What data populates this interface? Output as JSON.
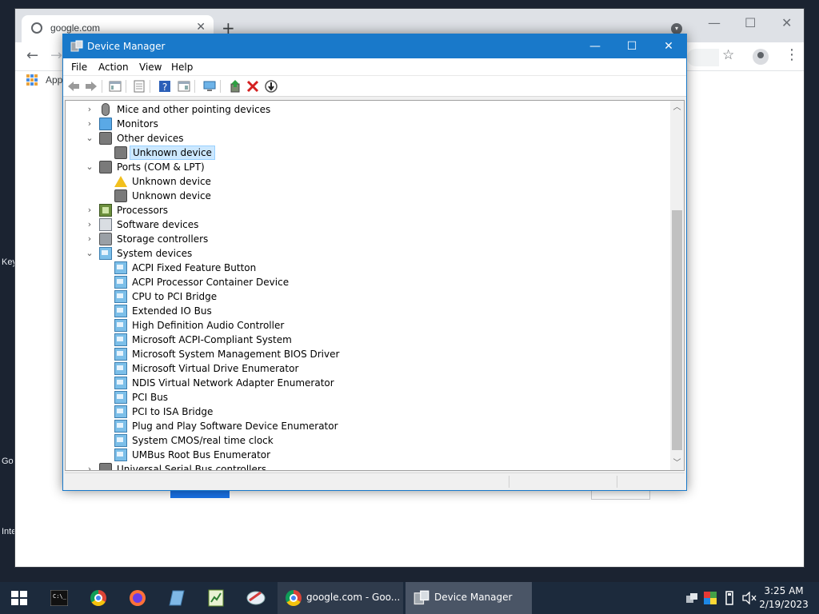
{
  "desktop": {
    "labels": [
      "Key",
      "Go",
      "Inte"
    ]
  },
  "chrome": {
    "tab_title": "google.com",
    "tab_close": "✕",
    "new_tab": "+",
    "bookmarks_label": "Apps",
    "win_minimize": "—",
    "win_maximize": "☐",
    "win_close": "✕"
  },
  "device_manager": {
    "title": "Device Manager",
    "window_controls": {
      "minimize": "—",
      "maximize": "☐",
      "close": "✕"
    },
    "menu": [
      "File",
      "Action",
      "View",
      "Help"
    ],
    "toolbar": [
      "back-icon",
      "forward-icon",
      "show-hide-console-tree-icon",
      "properties-icon",
      "help-icon",
      "action-pane-icon",
      "scan-hardware-icon",
      "update-driver-icon",
      "uninstall-device-icon",
      "disable-device-icon"
    ],
    "tree": [
      {
        "label": "Mice and other pointing devices",
        "level": 1,
        "expanded": false,
        "icon": "mouse-icon"
      },
      {
        "label": "Monitors",
        "level": 1,
        "expanded": false,
        "icon": "monitor-icon"
      },
      {
        "label": "Other devices",
        "level": 1,
        "expanded": true,
        "icon": "unknown-device-icon"
      },
      {
        "label": "Unknown device",
        "level": 2,
        "selected": true,
        "icon": "unknown-device-icon"
      },
      {
        "label": "Ports (COM & LPT)",
        "level": 1,
        "expanded": true,
        "icon": "port-icon"
      },
      {
        "label": "Unknown device",
        "level": 2,
        "icon": "warning-icon"
      },
      {
        "label": "Unknown device",
        "level": 2,
        "icon": "port-icon"
      },
      {
        "label": "Processors",
        "level": 1,
        "expanded": false,
        "icon": "processor-icon"
      },
      {
        "label": "Software devices",
        "level": 1,
        "expanded": false,
        "icon": "software-device-icon"
      },
      {
        "label": "Storage controllers",
        "level": 1,
        "expanded": false,
        "icon": "storage-controller-icon"
      },
      {
        "label": "System devices",
        "level": 1,
        "expanded": true,
        "icon": "system-device-icon"
      },
      {
        "label": "ACPI Fixed Feature Button",
        "level": 2,
        "icon": "system-device-icon"
      },
      {
        "label": "ACPI Processor Container Device",
        "level": 2,
        "icon": "system-device-icon"
      },
      {
        "label": "CPU to PCI Bridge",
        "level": 2,
        "icon": "system-device-icon"
      },
      {
        "label": "Extended IO Bus",
        "level": 2,
        "icon": "system-device-icon"
      },
      {
        "label": "High Definition Audio Controller",
        "level": 2,
        "icon": "system-device-icon"
      },
      {
        "label": "Microsoft ACPI-Compliant System",
        "level": 2,
        "icon": "system-device-icon"
      },
      {
        "label": "Microsoft System Management BIOS Driver",
        "level": 2,
        "icon": "system-device-icon"
      },
      {
        "label": "Microsoft Virtual Drive Enumerator",
        "level": 2,
        "icon": "system-device-icon"
      },
      {
        "label": "NDIS Virtual Network Adapter Enumerator",
        "level": 2,
        "icon": "system-device-icon"
      },
      {
        "label": "PCI Bus",
        "level": 2,
        "icon": "system-device-icon"
      },
      {
        "label": "PCI to ISA Bridge",
        "level": 2,
        "icon": "system-device-icon"
      },
      {
        "label": "Plug and Play Software Device Enumerator",
        "level": 2,
        "icon": "system-device-icon"
      },
      {
        "label": "System CMOS/real time clock",
        "level": 2,
        "icon": "system-device-icon"
      },
      {
        "label": "UMBus Root Bus Enumerator",
        "level": 2,
        "icon": "system-device-icon"
      },
      {
        "label": "Universal Serial Bus controllers",
        "level": 1,
        "expanded": false,
        "icon": "usb-icon"
      }
    ]
  },
  "taskbar": {
    "pinned": [
      "terminal-icon",
      "chrome-icon",
      "firefox-icon",
      "notepad-icon",
      "spreadsheet-icon",
      "paint-icon"
    ],
    "open_apps": [
      {
        "label": "google.com - Goo...",
        "icon": "chrome-icon",
        "active": false
      },
      {
        "label": "Device Manager",
        "icon": "device-manager-icon",
        "active": true
      }
    ],
    "tray_icons": [
      "device-tray-icon",
      "color-tray-icon",
      "usb-tray-icon",
      "volume-muted-icon"
    ],
    "time": "3:25 AM",
    "date": "2/19/2023"
  }
}
